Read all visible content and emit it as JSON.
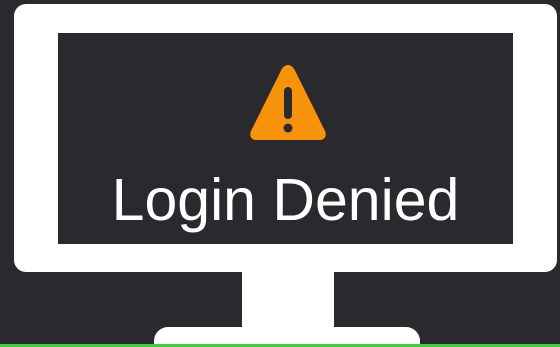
{
  "screen": {
    "message": "Login Denied",
    "icon": "warning-icon"
  },
  "colors": {
    "background": "#2a292e",
    "monitor": "#ffffff",
    "warning": "#f7930a",
    "accent_line": "#3ecf3e"
  }
}
